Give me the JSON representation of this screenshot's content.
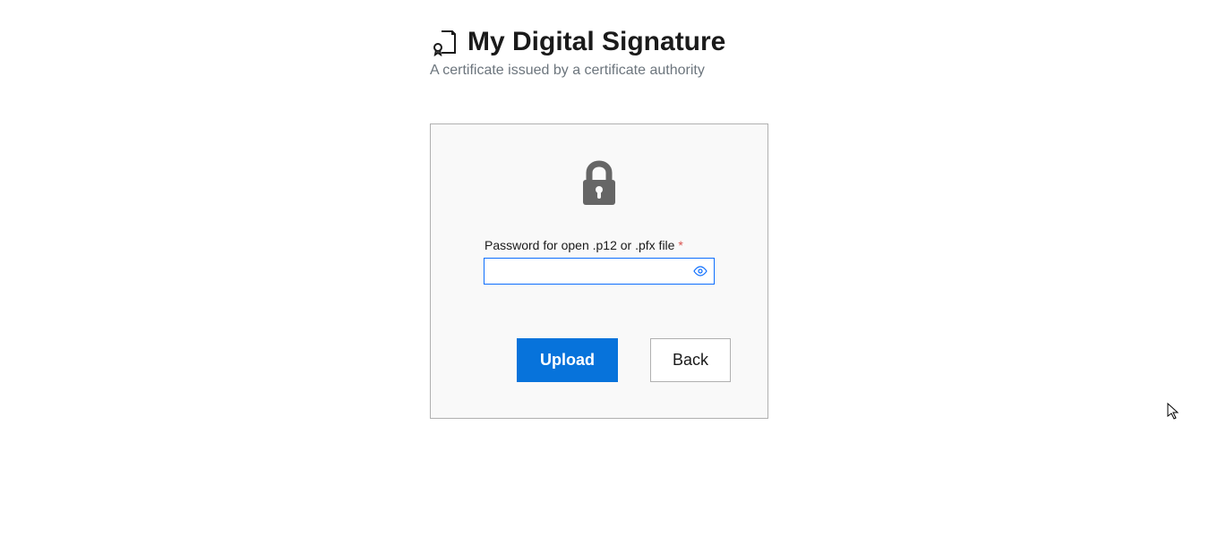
{
  "header": {
    "title": "My Digital Signature",
    "subtitle": "A certificate issued by a certificate authority"
  },
  "form": {
    "password_label": "Password for open .p12 or .pfx file",
    "required_mark": "*",
    "password_value": "",
    "upload_label": "Upload",
    "back_label": "Back"
  }
}
